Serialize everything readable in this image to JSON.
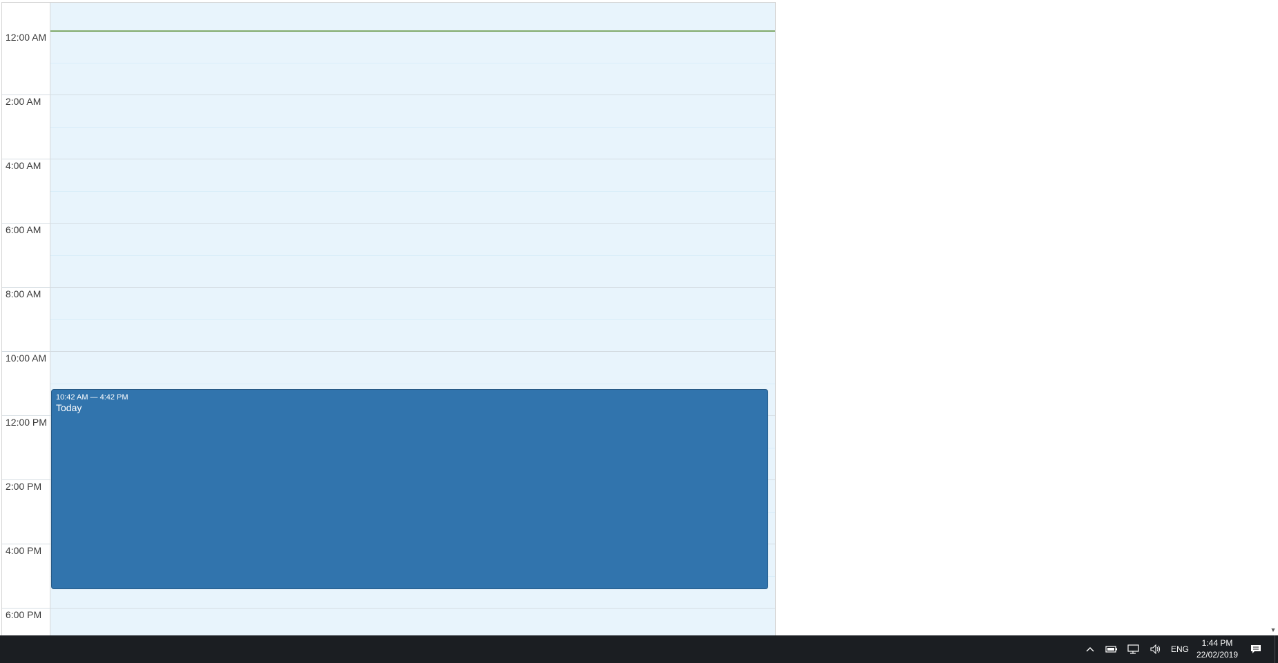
{
  "calendar": {
    "time_labels": [
      "12:00 AM",
      "2:00 AM",
      "4:00 AM",
      "6:00 AM",
      "8:00 AM",
      "10:00 AM",
      "12:00 PM",
      "2:00 PM",
      "4:00 PM",
      "6:00 PM"
    ],
    "event": {
      "time_range": "10:42 AM — 4:42 PM",
      "title": "Today",
      "color": "#3174ad"
    },
    "day_background": "#e8f4fc",
    "now_line_color": "#7fa96a"
  },
  "taskbar": {
    "language": "ENG",
    "time": "1:44 PM",
    "date": "22/02/2019",
    "icons": [
      "chevron-up-icon",
      "battery-icon",
      "network-icon",
      "volume-icon",
      "notification-icon"
    ]
  }
}
